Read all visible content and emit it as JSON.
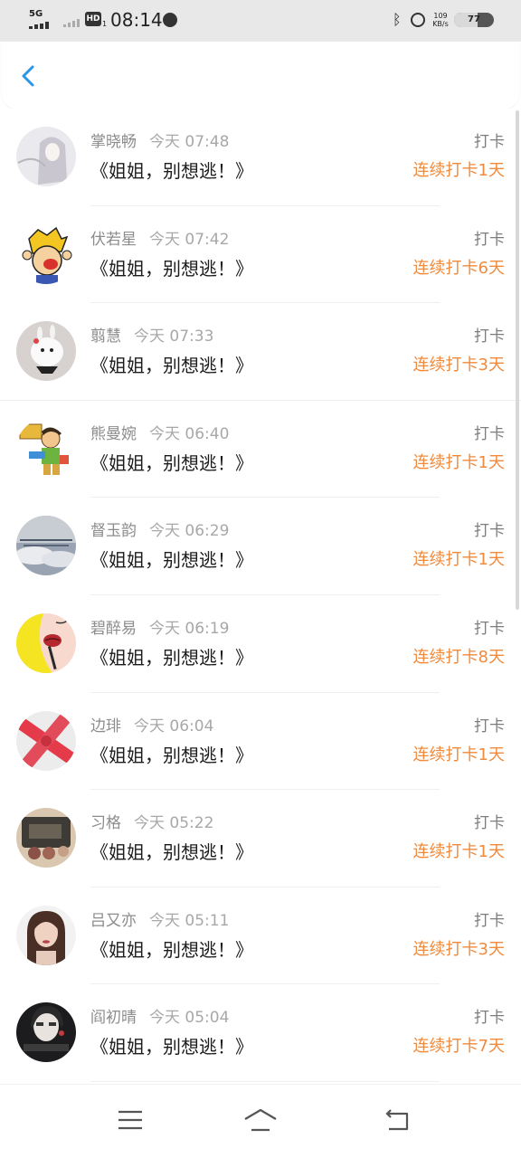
{
  "status_bar": {
    "network": "5G",
    "hd": "HD",
    "hd_sub": "1",
    "time": "08:14",
    "speed_value": "109",
    "speed_unit": "KB/s",
    "battery": "77"
  },
  "header": {
    "back_icon": "chevron-left-icon"
  },
  "colors": {
    "accent": "#f08a3c",
    "back": "#2b97e8",
    "name": "#8c8c8c"
  },
  "entries": [
    {
      "name": "掌晓畅",
      "time": "今天 07:48",
      "title": "《姐姐，别想逃！》",
      "tag": "打卡",
      "streak": "连续打卡1天"
    },
    {
      "name": "伏若星",
      "time": "今天 07:42",
      "title": "《姐姐，别想逃！》",
      "tag": "打卡",
      "streak": "连续打卡6天"
    },
    {
      "name": "翦慧",
      "time": "今天 07:33",
      "title": "《姐姐，别想逃！》",
      "tag": "打卡",
      "streak": "连续打卡3天"
    },
    {
      "name": "熊曼婉",
      "time": "今天 06:40",
      "title": "《姐姐，别想逃！》",
      "tag": "打卡",
      "streak": "连续打卡1天"
    },
    {
      "name": "督玉韵",
      "time": "今天 06:29",
      "title": "《姐姐，别想逃！》",
      "tag": "打卡",
      "streak": "连续打卡1天"
    },
    {
      "name": "碧醉易",
      "time": "今天 06:19",
      "title": "《姐姐，别想逃！》",
      "tag": "打卡",
      "streak": "连续打卡8天"
    },
    {
      "name": "边琲",
      "time": "今天 06:04",
      "title": "《姐姐，别想逃！》",
      "tag": "打卡",
      "streak": "连续打卡1天"
    },
    {
      "name": "习格",
      "time": "今天 05:22",
      "title": "《姐姐，别想逃！》",
      "tag": "打卡",
      "streak": "连续打卡1天"
    },
    {
      "name": "吕又亦",
      "time": "今天 05:11",
      "title": "《姐姐，别想逃！》",
      "tag": "打卡",
      "streak": "连续打卡3天"
    },
    {
      "name": "阎初晴",
      "time": "今天 05:04",
      "title": "《姐姐，别想逃！》",
      "tag": "打卡",
      "streak": "连续打卡7天"
    }
  ],
  "nav": {
    "menu_icon": "menu-icon",
    "home_icon": "home-icon",
    "back_icon": "back-icon"
  }
}
